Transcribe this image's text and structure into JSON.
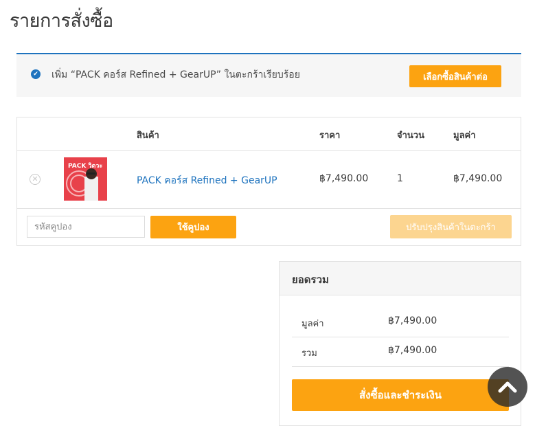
{
  "page": {
    "title": "รายการสั่งซื้อ"
  },
  "notice": {
    "message": "เพิ่ม “PACK คอร์ส Refined + GearUP” ในตะกร้าเรียบร้อย",
    "continue_label": "เลือกซื้อสินค้าต่อ",
    "check_icon": "check-circle-icon"
  },
  "cart": {
    "headers": {
      "product": "สินค้า",
      "price": "ราคา",
      "quantity": "จำนวน",
      "subtotal": "มูลค่า"
    },
    "items": [
      {
        "name": "PACK คอร์ส Refined + GearUP",
        "price": "฿7,490.00",
        "quantity": "1",
        "subtotal": "฿7,490.00",
        "thumb_text": "PACK วิดวะ"
      }
    ],
    "coupon_placeholder": "รหัสคูปอง",
    "apply_coupon_label": "ใช้คูปอง",
    "update_cart_label": "ปรับปรุงสินค้าในตะกร้า"
  },
  "totals": {
    "heading": "ยอดรวม",
    "subtotal_label": "มูลค่า",
    "subtotal_value": "฿7,490.00",
    "total_label": "รวม",
    "total_value": "฿7,490.00",
    "checkout_label": "สั่งซื้อและชำระเงิน"
  },
  "colors": {
    "accent": "#fca311",
    "link": "#1e73be",
    "accent_disabled": "#fcd590"
  }
}
